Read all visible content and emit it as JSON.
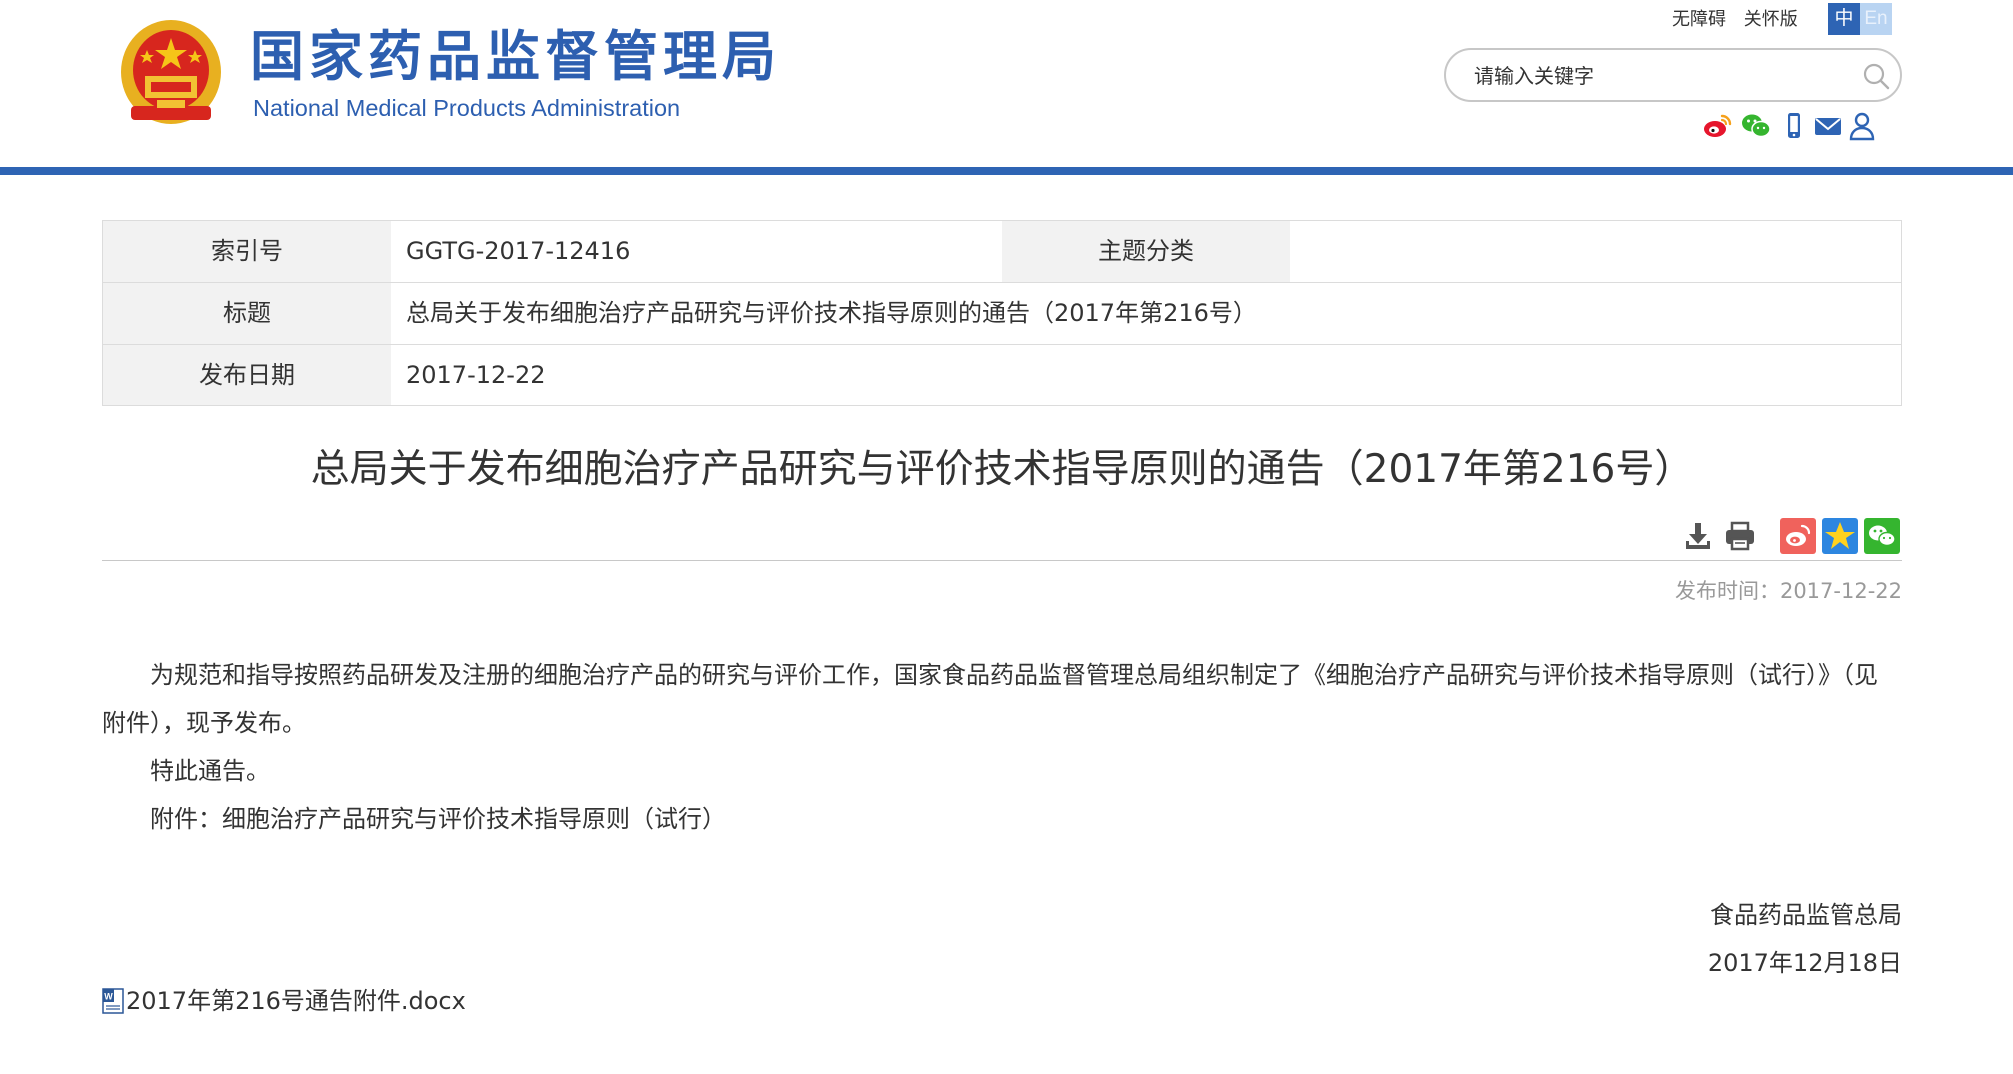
{
  "header": {
    "title_cn": "国家药品监督管理局",
    "title_en": "National Medical Products Administration",
    "top_links": [
      "无障碍",
      "关怀版"
    ],
    "lang": {
      "zh": "中",
      "en": "En"
    },
    "search": {
      "placeholder": "请输入关键字"
    },
    "social_icons": [
      "weibo-icon",
      "wechat-icon",
      "mobile-icon",
      "mail-icon",
      "user-icon"
    ],
    "accent_color": "#2e64b4"
  },
  "meta": {
    "index_label": "索引号",
    "index_value": "GGTG-2017-12416",
    "category_label": "主题分类",
    "category_value": "",
    "title_label": "标题",
    "title_value": "总局关于发布细胞治疗产品研究与评价技术指导原则的通告（2017年第216号）",
    "date_label": "发布日期",
    "date_value": "2017-12-22"
  },
  "article": {
    "title": "总局关于发布细胞治疗产品研究与评价技术指导原则的通告（2017年第216号）",
    "tool_icons": [
      "download-icon",
      "print-icon",
      "weibo-share-icon",
      "favorite-icon",
      "wechat-share-icon"
    ],
    "publish_time": "发布时间：2017-12-22",
    "paragraph1_line1": "为规范和指导按照药品研发及注册的细胞治疗产品的研究与评价工作，国家食品药品监督管理总局组织制定了《细胞治疗产品研究与评价技术指导原则（试行）》（见",
    "paragraph1_line2": "附件），现予发布。",
    "paragraph2": "特此通告。",
    "paragraph3": "附件：细胞治疗产品研究与评价技术指导原则（试行）",
    "signature_org": "食品药品监管总局",
    "signature_date": "2017年12月18日",
    "attachment_file": "2017年第216号通告附件.docx"
  }
}
